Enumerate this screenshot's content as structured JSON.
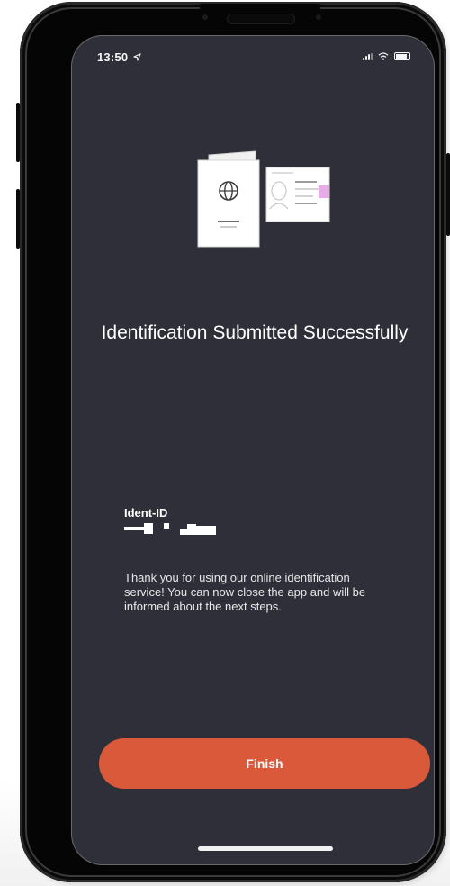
{
  "status_bar": {
    "time": "13:50",
    "location_icon": "location-arrow-icon",
    "signal_icon": "cellular-signal-icon",
    "wifi_icon": "wifi-icon",
    "battery_icon": "battery-icon"
  },
  "illustration": {
    "icon": "passport-and-id-card-icon"
  },
  "main": {
    "title": "Identification Submitted Successfully",
    "ident_label": "Ident-ID",
    "ident_value_icon": "redacted-code-icon",
    "message": "Thank you for using our online identification service! You can now close the app and will be informed about the next steps."
  },
  "actions": {
    "finish_label": "Finish"
  },
  "colors": {
    "background": "#2e2f38",
    "accent": "#d9593a",
    "text": "#ffffff"
  }
}
